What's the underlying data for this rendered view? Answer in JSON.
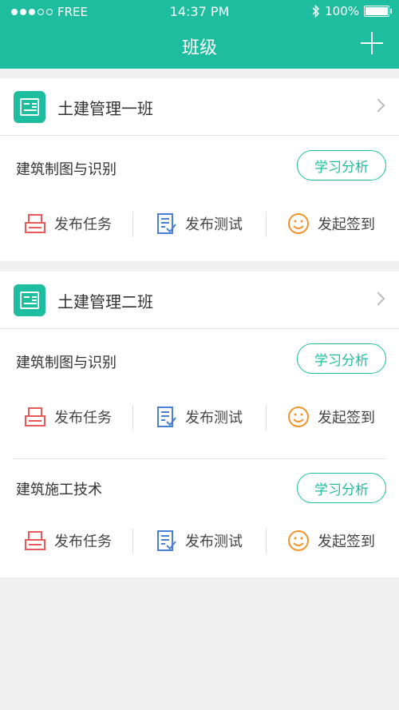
{
  "status_bar": {
    "carrier": "FREE",
    "time": "14:37 PM",
    "battery": "100%",
    "battery_level": 1.0
  },
  "header": {
    "title": "班级"
  },
  "classes": [
    {
      "name": "土建管理一班",
      "courses": [
        {
          "name": "建筑制图与识别",
          "analysis_label": "学习分析",
          "actions": {
            "task": "发布任务",
            "test": "发布测试",
            "checkin": "发起签到"
          }
        }
      ]
    },
    {
      "name": "土建管理二班",
      "courses": [
        {
          "name": "建筑制图与识别",
          "analysis_label": "学习分析",
          "actions": {
            "task": "发布任务",
            "test": "发布测试",
            "checkin": "发起签到"
          }
        },
        {
          "name": "建筑施工技术",
          "analysis_label": "学习分析",
          "actions": {
            "task": "发布任务",
            "test": "发布测试",
            "checkin": "发起签到"
          }
        }
      ]
    }
  ],
  "colors": {
    "primary": "#1fbd9f",
    "task_icon": "#e85a5a",
    "test_icon": "#4a7fd6",
    "checkin_icon": "#f0952d",
    "background": "#f0f0f0"
  },
  "icons": {
    "class": "class-doc-icon",
    "task": "printer-icon",
    "test": "checklist-icon",
    "checkin": "smiley-icon",
    "add": "plus-icon",
    "chevron": "chevron-right-icon"
  }
}
